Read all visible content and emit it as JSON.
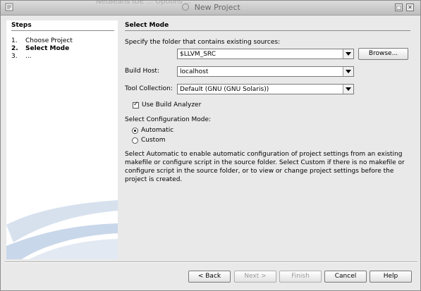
{
  "window": {
    "title": "New Project",
    "background_title": "NetBeans IDE ... Options ..."
  },
  "steps": {
    "heading": "Steps",
    "items": [
      {
        "num": "1.",
        "label": "Choose Project"
      },
      {
        "num": "2.",
        "label": "Select Mode"
      },
      {
        "num": "3.",
        "label": "..."
      }
    ]
  },
  "panel": {
    "heading": "Select Mode",
    "source_label": "Specify the folder that contains existing sources:",
    "source_value": "$LLVM_SRC",
    "browse_label": "Browse...",
    "build_host_label": "Build Host:",
    "build_host_value": "localhost",
    "tool_collection_label": "Tool Collection:",
    "tool_collection_value": "Default (GNU (GNU Solaris))",
    "analyzer_label": "Use Build Analyzer",
    "analyzer_checked": true,
    "config_mode_label": "Select Configuration Mode:",
    "mode_automatic": "Automatic",
    "mode_custom": "Custom",
    "mode_selected": "Automatic",
    "description": "Select Automatic to enable automatic configuration of project settings from an existing makefile or configure script in the source folder. Select Custom if there is no makefile or configure script in the source folder, or to view or change project settings before the project is created."
  },
  "footer": {
    "back": "< Back",
    "next": "Next >",
    "finish": "Finish",
    "cancel": "Cancel",
    "help": "Help"
  },
  "colors": {
    "window_bg": "#e9e9e9",
    "steps_bg": "#ffffff",
    "deco_blue": "#c9d7ea"
  }
}
